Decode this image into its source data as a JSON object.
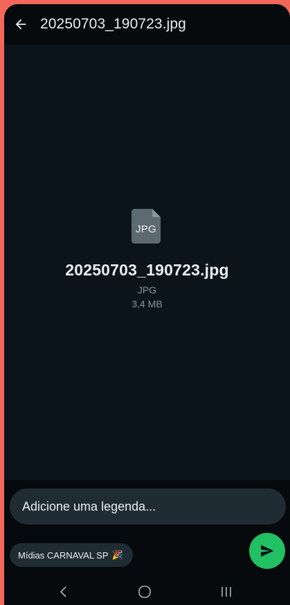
{
  "header": {
    "title": "20250703_190723.jpg",
    "back_icon": "arrow-left-icon"
  },
  "file": {
    "icon_label": "JPG",
    "name": "20250703_190723.jpg",
    "type": "JPG",
    "size": "3,4 MB"
  },
  "composer": {
    "caption_placeholder": "Adicione uma legenda...",
    "recipient": "Mídias CARNAVAL SP",
    "recipient_emoji": "🎉",
    "send_icon": "send-icon",
    "send_color": "#21c063"
  },
  "system_nav": {
    "back_icon": "chevron-left-icon",
    "home_icon": "circle-home-icon",
    "recents_icon": "recents-lines-icon"
  },
  "colors": {
    "background": "#0b141a",
    "outer": "#f2675a",
    "accent": "#21c063"
  }
}
